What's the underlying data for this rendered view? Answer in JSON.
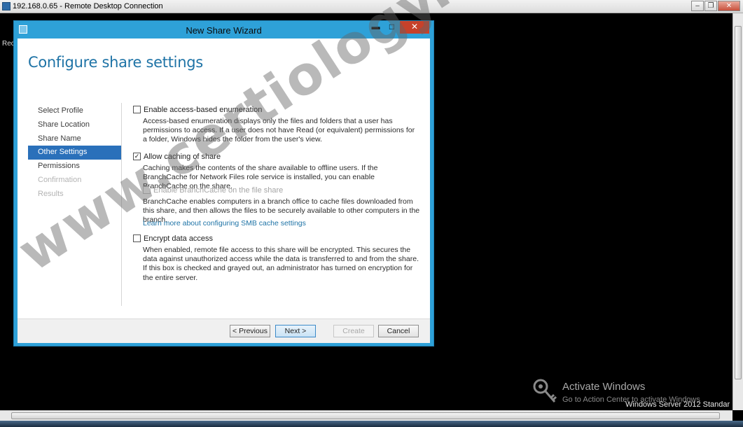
{
  "rdp": {
    "title": "192.168.0.65 - Remote Desktop Connection",
    "minimize_glyph": "–",
    "restore_glyph": "❐",
    "close_glyph": "✕",
    "remote_label": "Rec"
  },
  "wizard": {
    "title": "New Share Wizard",
    "minimize_glyph": "▬",
    "maximize_glyph": "□",
    "close_glyph": "✕",
    "heading": "Configure share settings",
    "nav": [
      {
        "label": "Select Profile",
        "state": "normal"
      },
      {
        "label": "Share Location",
        "state": "normal"
      },
      {
        "label": "Share Name",
        "state": "normal"
      },
      {
        "label": "Other Settings",
        "state": "active"
      },
      {
        "label": "Permissions",
        "state": "normal"
      },
      {
        "label": "Confirmation",
        "state": "disabled"
      },
      {
        "label": "Results",
        "state": "disabled"
      }
    ],
    "options": {
      "abe": {
        "label": "Enable access-based enumeration",
        "checked": false,
        "description": "Access-based enumeration displays only the files and folders that a user has permissions to access. If a user does not have Read (or equivalent) permissions for a folder, Windows hides the folder from the user's view."
      },
      "caching": {
        "label": "Allow caching of share",
        "checked": true,
        "check_glyph": "✓",
        "description": "Caching makes the contents of the share available to offline users. If the BranchCache for Network Files role service is installed, you can enable BranchCache on the share."
      },
      "branchcache": {
        "label": "Enable BranchCache on the file share",
        "checked": false,
        "enabled": false,
        "description": "BranchCache enables computers in a branch office to cache files downloaded from this share, and then allows the files to be securely available to other computers in the branch."
      },
      "smb_link": "Learn more about configuring SMB cache settings",
      "encrypt": {
        "label": "Encrypt data access",
        "checked": false,
        "description": "When enabled, remote file access to this share will be encrypted. This secures the data against unauthorized access while the data is transferred to and from the share. If this box is checked and grayed out, an administrator has turned on encryption for the entire server."
      }
    },
    "buttons": {
      "previous": "< Previous",
      "next": "Next >",
      "create": "Create",
      "cancel": "Cancel"
    }
  },
  "desktop": {
    "activate_title": "Activate Windows",
    "activate_sub": "Go to Action Center to activate Windows",
    "server_label": "Windows Server 2012 Standar"
  },
  "watermark": "www.certiology.com",
  "colors": {
    "wizard_frame": "#2ea1d8",
    "nav_active": "#2a70ba",
    "heading": "#1e73a6",
    "link": "#1e73a6",
    "close_red": "#c7412a"
  }
}
